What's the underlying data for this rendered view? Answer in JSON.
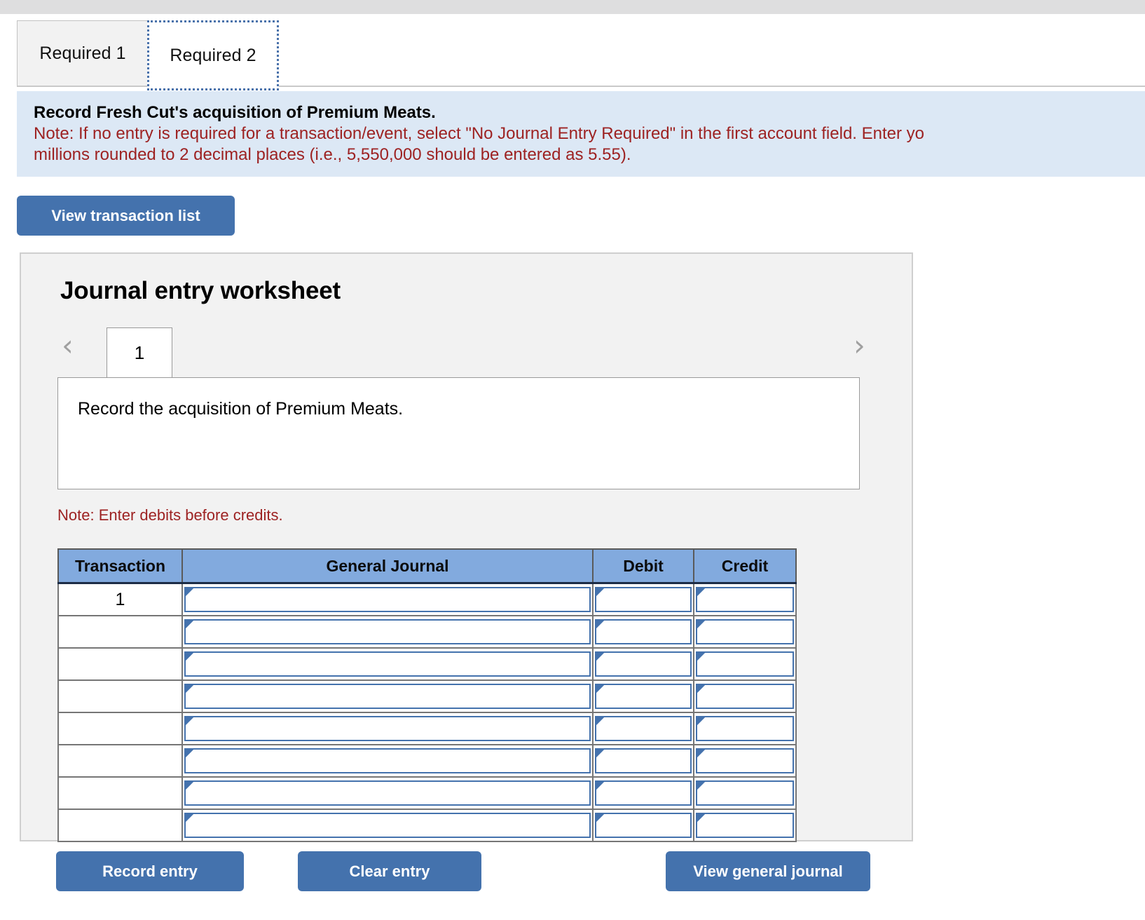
{
  "top_strip": {},
  "tabs": [
    {
      "label": "Required 1",
      "selected": false
    },
    {
      "label": "Required 2",
      "selected": true
    }
  ],
  "banner": {
    "title": "Record Fresh Cut's acquisition of Premium Meats.",
    "note_line_1": "Note: If no entry is required for a transaction/event, select \"No Journal Entry Required\" in the first account field. Enter yo",
    "note_line_2": "millions rounded to 2 decimal places (i.e., 5,550,000 should be entered as 5.55)."
  },
  "toolbar": {
    "view_transaction_list_label": "View transaction list"
  },
  "worksheet": {
    "title": "Journal entry worksheet",
    "prev_icon": "chevron-left-icon",
    "next_icon": "chevron-right-icon",
    "current_page": "1",
    "description": "Record the acquisition of Premium Meats.",
    "note": "Note: Enter debits before credits."
  },
  "table": {
    "headers": [
      "Transaction",
      "General Journal",
      "Debit",
      "Credit"
    ],
    "rows": [
      {
        "transaction": "1",
        "general_journal": "",
        "debit": "",
        "credit": ""
      },
      {
        "transaction": "",
        "general_journal": "",
        "debit": "",
        "credit": ""
      },
      {
        "transaction": "",
        "general_journal": "",
        "debit": "",
        "credit": ""
      },
      {
        "transaction": "",
        "general_journal": "",
        "debit": "",
        "credit": ""
      },
      {
        "transaction": "",
        "general_journal": "",
        "debit": "",
        "credit": ""
      },
      {
        "transaction": "",
        "general_journal": "",
        "debit": "",
        "credit": ""
      },
      {
        "transaction": "",
        "general_journal": "",
        "debit": "",
        "credit": ""
      },
      {
        "transaction": "",
        "general_journal": "",
        "debit": "",
        "credit": ""
      }
    ]
  },
  "actions": {
    "record_entry_label": "Record entry",
    "clear_entry_label": "Clear entry",
    "view_general_journal_label": "View general journal"
  },
  "colors": {
    "accent_blue": "#4472ad",
    "header_blue": "#82aade",
    "banner_bg": "#dce8f5",
    "note_red": "#9d2222",
    "panel_bg": "#f2f2f2"
  }
}
